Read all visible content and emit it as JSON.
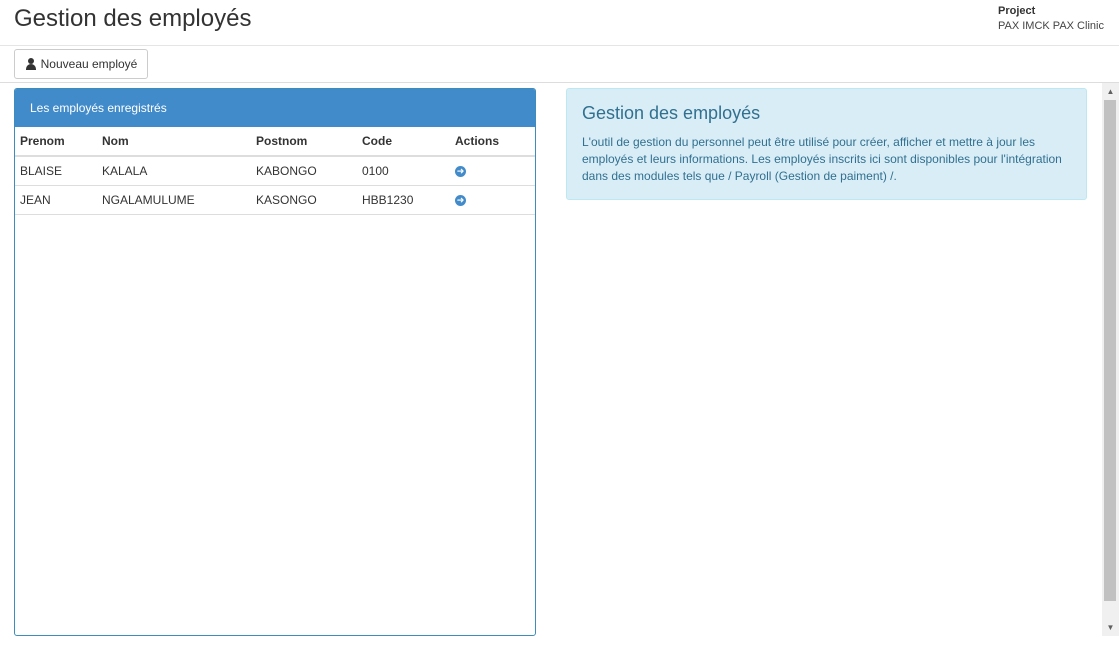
{
  "header": {
    "title": "Gestion des employés",
    "project_label": "Project",
    "project_name": "PAX IMCK PAX Clinic"
  },
  "toolbar": {
    "new_employee_label": "Nouveau employé",
    "new_employee_icon": "user-icon"
  },
  "panel": {
    "heading": "Les employés enregistrés",
    "columns": [
      "Prenom",
      "Nom",
      "Postnom",
      "Code",
      "Actions"
    ],
    "rows": [
      {
        "prenom": "BLAISE",
        "nom": "KALALA",
        "postnom": "KABONGO",
        "code": "0100",
        "action_icon": "arrow-circle-right-icon"
      },
      {
        "prenom": "JEAN",
        "nom": "NGALAMULUME",
        "postnom": "KASONGO",
        "code": "HBB1230",
        "action_icon": "arrow-circle-right-icon"
      }
    ]
  },
  "info": {
    "title": "Gestion des employés",
    "text": "L'outil de gestion du personnel peut être utilisé pour créer, afficher et mettre à jour les employés et leurs informations. Les employés inscrits ici sont disponibles pour l'intégration dans des modules tels que / Payroll (Gestion de paiment) /."
  },
  "colors": {
    "panel_header": "#428bca",
    "info_bg": "#d9edf7",
    "info_text": "#31708f"
  }
}
